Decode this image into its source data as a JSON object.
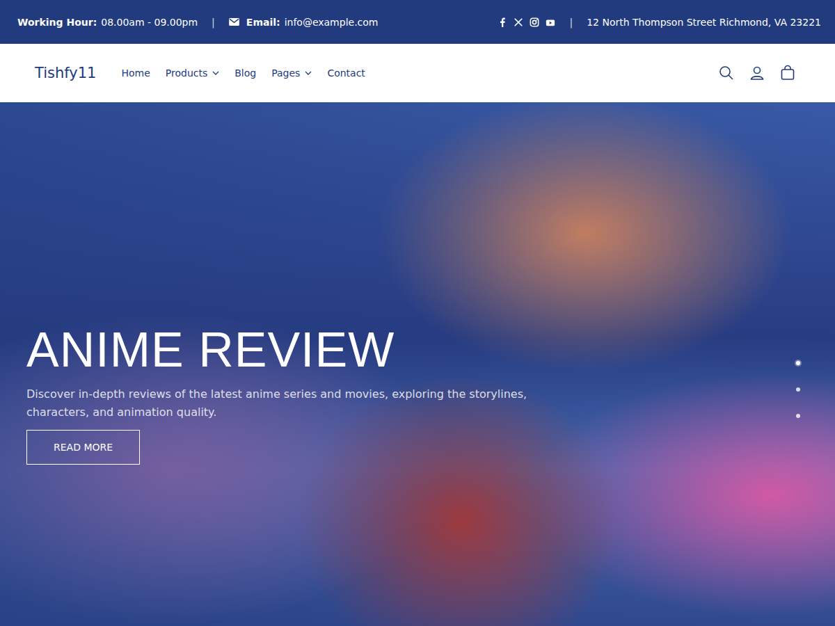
{
  "top_bar": {
    "working_hour_label": "Working Hour:",
    "working_hour": "08.00am - 09.00pm",
    "separator": "|",
    "email_label": "Email:",
    "email": "info@example.com",
    "address": "12 North Thompson Street Richmond, VA 23221"
  },
  "header": {
    "logo": "Tishfy11",
    "nav": [
      {
        "label": "Home",
        "dropdown": false
      },
      {
        "label": "Products",
        "dropdown": true
      },
      {
        "label": "Blog",
        "dropdown": false
      },
      {
        "label": "Pages",
        "dropdown": true
      },
      {
        "label": "Contact",
        "dropdown": false
      }
    ]
  },
  "hero": {
    "title": "ANIME REVIEW",
    "description": "Discover in-depth reviews of the latest anime series and movies, exploring the storylines, characters, and animation quality.",
    "button": "READ MORE",
    "dots": [
      {
        "selected": true
      },
      {
        "selected": false
      },
      {
        "selected": false
      }
    ]
  }
}
